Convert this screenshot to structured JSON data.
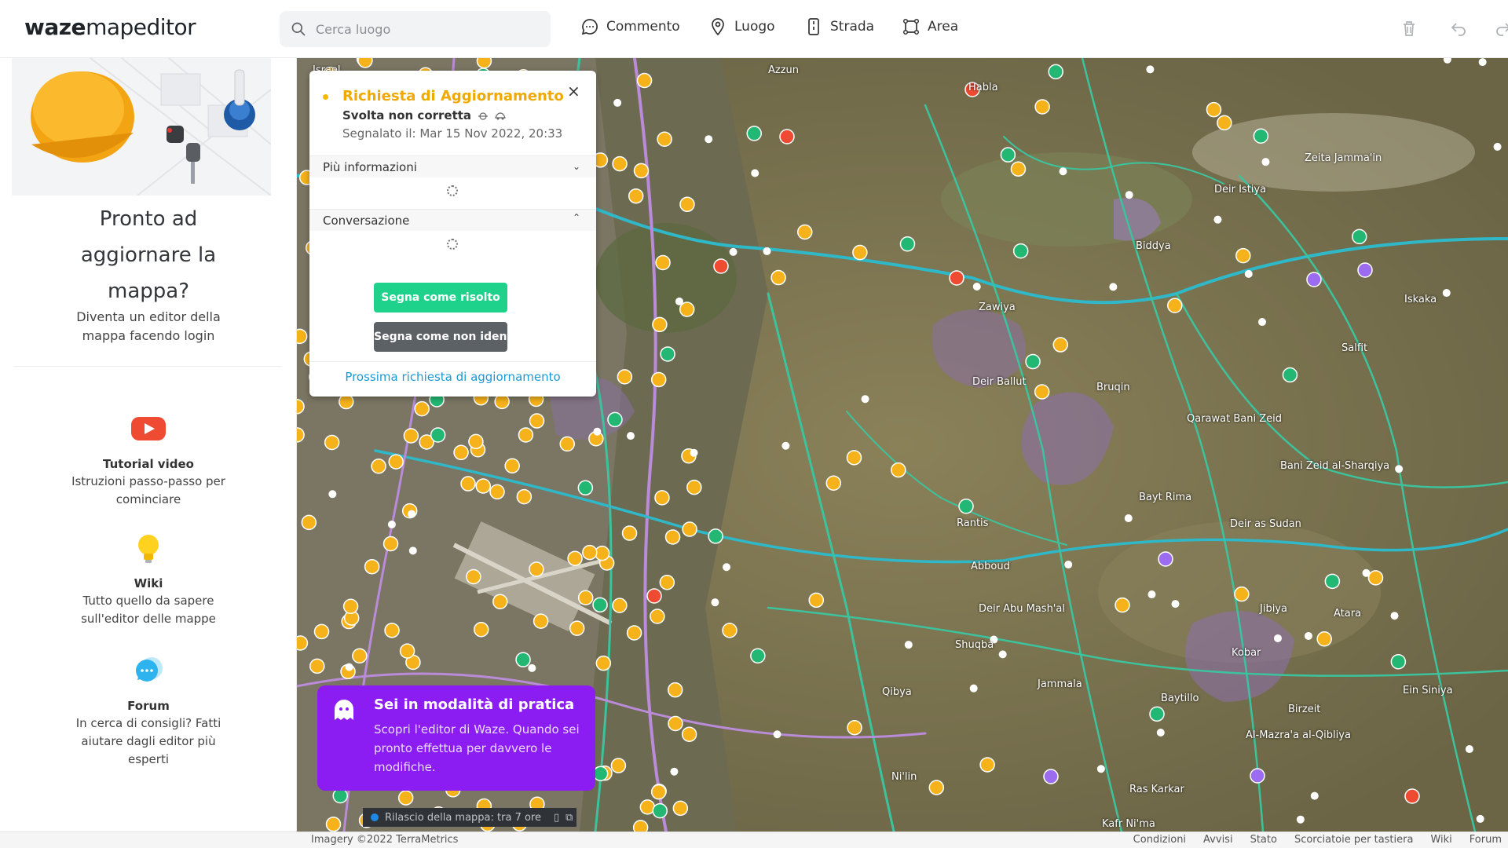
{
  "header": {
    "logo_bold": "waze",
    "logo_rest": "mapeditor",
    "search_placeholder": "Cerca luogo",
    "tools": [
      {
        "label": "Commento",
        "icon": "comment-icon"
      },
      {
        "label": "Luogo",
        "icon": "place-pin-icon"
      },
      {
        "label": "Strada",
        "icon": "road-icon"
      },
      {
        "label": "Area",
        "icon": "area-icon"
      }
    ],
    "right_icons": [
      "trash-icon",
      "undo-icon",
      "redo-icon"
    ]
  },
  "sidebar": {
    "title": "Pronto ad aggiornare la mappa?",
    "subtitle": "Diventa un editor della mappa facendo login",
    "items": [
      {
        "title": "Tutorial video",
        "desc": "Istruzioni passo-passo per cominciare",
        "icon": "video-play-icon"
      },
      {
        "title": "Wiki",
        "desc": "Tutto quello da sapere sull'editor delle mappe",
        "icon": "lightbulb-icon"
      },
      {
        "title": "Forum",
        "desc": "In cerca di consigli? Fatti aiutare dagli editor più esperti",
        "icon": "chat-bubble-icon"
      }
    ]
  },
  "panel": {
    "title": "Richiesta di Aggiornamento",
    "close": "×",
    "type": "Svolta non corretta",
    "date": "Segnalato il: Mar 15 Nov 2022, 20:33",
    "more_info": "Più informazioni",
    "conversation": "Conversazione",
    "btn_solved": "Segna come risolto",
    "btn_not_identified": "Segna come non identificato",
    "next": "Prossima richiesta di aggiornamento"
  },
  "practice": {
    "title": "Sei in modalità di pratica",
    "text": "Scopri l'editor di Waze. Quando sei pronto effettua per davvero le modifiche."
  },
  "release": {
    "text": "Rilascio della mappa: tra 7 ore"
  },
  "map_labels": [
    {
      "text": "Israel"
    },
    {
      "text": "Azzun"
    },
    {
      "text": "Habla"
    },
    {
      "text": "Deir Istiya"
    },
    {
      "text": "Zeita Jamma'in"
    },
    {
      "text": "Biddya"
    },
    {
      "text": "Zawiya"
    },
    {
      "text": "Salfit"
    },
    {
      "text": "Iskaka"
    },
    {
      "text": "Deir Ballut"
    },
    {
      "text": "Bruqin"
    },
    {
      "text": "Qarawat Bani Zeid"
    },
    {
      "text": "Bani Zeid al-Sharqiya"
    },
    {
      "text": "Bayt Rima"
    },
    {
      "text": "Rantis"
    },
    {
      "text": "Deir as Sudan"
    },
    {
      "text": "Abboud"
    },
    {
      "text": "Deir Abu Mash'al"
    },
    {
      "text": "Jibiya"
    },
    {
      "text": "Kobar"
    },
    {
      "text": "Shuqba"
    },
    {
      "text": "Jammala"
    },
    {
      "text": "Qibya"
    },
    {
      "text": "Baytillo"
    },
    {
      "text": "Birzeit"
    },
    {
      "text": "Al-Mazra'a al-Qibliya"
    },
    {
      "text": "Ein Siniya"
    },
    {
      "text": "Ni'lin"
    },
    {
      "text": "Ras Karkar"
    },
    {
      "text": "Kafr Ni'ma"
    },
    {
      "text": "Atara"
    }
  ],
  "footer": {
    "imagery": "Imagery ©2022 TerraMetrics",
    "links": [
      "Condizioni",
      "Avvisi",
      "Stato",
      "Scorciatoie per tastiera",
      "Wiki",
      "Forum"
    ]
  },
  "colors": {
    "accent_green": "#1fd28b",
    "request_yellow": "#f0a900",
    "practice_purple": "#8b1cf2",
    "link_blue": "#1a9bd7"
  }
}
